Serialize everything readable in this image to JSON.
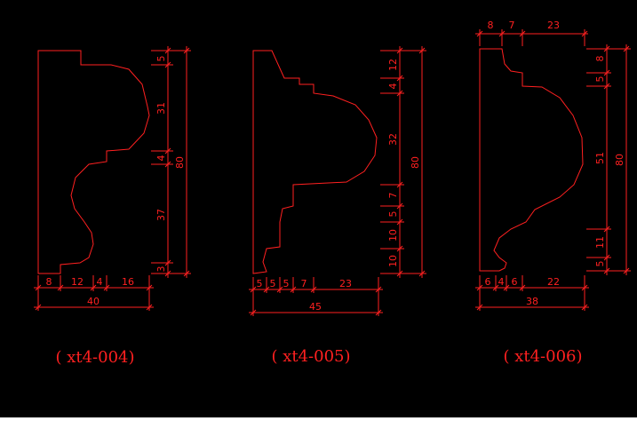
{
  "profiles": [
    {
      "caption": "( xt4-004)",
      "top_dims": [],
      "right_dims": [
        "5",
        "31",
        "4",
        "37",
        "3"
      ],
      "total_right": "80",
      "bottom_dims": [
        "8",
        "12",
        "4",
        "16"
      ],
      "total_bottom": "40"
    },
    {
      "caption": "( xt4-005)",
      "top_dims": [],
      "right_dims": [
        "12",
        "4",
        "32",
        "7",
        "5",
        "10",
        "10"
      ],
      "total_right": "80",
      "bottom_dims": [
        "5",
        "5",
        "5",
        "7",
        "23"
      ],
      "total_bottom": "45"
    },
    {
      "caption": "( xt4-006)",
      "top_dims": [
        "8",
        "7",
        "23"
      ],
      "right_dims": [
        "8",
        "5",
        "51",
        "11",
        "5"
      ],
      "total_right": "80",
      "bottom_dims": [
        "6",
        "4",
        "6",
        "22"
      ],
      "total_bottom": "38"
    }
  ],
  "colors": {
    "background": "#000000",
    "lines": "#ff2020"
  }
}
